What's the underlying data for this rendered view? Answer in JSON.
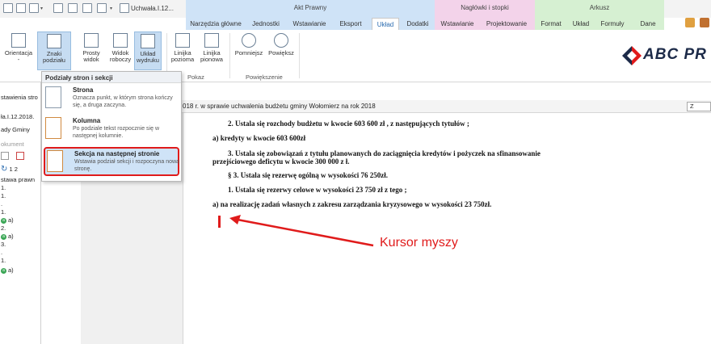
{
  "title_bar": {
    "document_title": "Uchwała.I.12...",
    "context_groups": [
      {
        "title": "Akt Prawny",
        "color": "#cfe3f7"
      },
      {
        "title": "Nagłówki i stopki",
        "color": "#f3d3ea"
      },
      {
        "title": "Arkusz",
        "color": "#d6f0d2"
      }
    ]
  },
  "tabs": [
    "Narzędzia główne",
    "Jednostki",
    "Wstawianie",
    "Eksport",
    "Układ",
    "Dodatki",
    "Wstawianie",
    "Projektowanie",
    "Format",
    "Układ",
    "Formuły",
    "Dane"
  ],
  "active_tab": "Układ",
  "ribbon": {
    "buttons": [
      {
        "label": "Orientacja",
        "sub": "-"
      },
      {
        "label": "Znaki",
        "sub": "podziału"
      },
      {
        "label": "Prosty",
        "sub": "widok"
      },
      {
        "label": "Widok",
        "sub": "roboczy"
      },
      {
        "label": "Układ",
        "sub": "wydruku"
      },
      {
        "label": "Linijka",
        "sub": "pozioma"
      },
      {
        "label": "Linijka",
        "sub": "pionowa"
      },
      {
        "label": "Pomniejsz",
        "sub": ""
      },
      {
        "label": "Powiększ",
        "sub": ""
      }
    ],
    "groups": {
      "pokaz": "Pokaz",
      "powiekszenie": "Powiększenie"
    }
  },
  "logo": {
    "text": "ABC PR",
    "color": "#1c2a48",
    "accent": "#e01b1b"
  },
  "left_panel": {
    "lines": [
      "stawienia stro",
      "ła.I.12.2018.",
      "ady Gminy",
      "okument",
      "1  2",
      "stawa prawn",
      "1.",
      "1.",
      ".",
      "1.",
      "a)",
      "2.",
      "a)",
      "3.",
      ".",
      "1.",
      "a)"
    ]
  },
  "dropdown": {
    "header": "Podziały stron i sekcji",
    "items": [
      {
        "title": "Strona",
        "desc": "Oznacza punkt, w którym strona kończy się, a druga zaczyna."
      },
      {
        "title": "Kolumna",
        "desc": "Po podziale tekst rozpocznie się w następnej kolumnie."
      },
      {
        "title": "Sekcja na następnej stronie",
        "desc": "Wstawia podział sekcji i rozpoczyna nową stronę."
      }
    ]
  },
  "doc_header": {
    "text": "018 r. w sprawie uchwalenia budżetu gminy Wołomierz na rok 2018",
    "right_button": "Z"
  },
  "document_lines": [
    "2. Ustala się  rozchody budżetu w kwocie 603 600 zł , z następujących tytułów ;",
    "a) kredyty w kwocie 603 600zł",
    "3. Ustala się zobowiązań z tytułu planowanych do zaciągnięcia kredytów i pożyczek na sfinansowanie",
    "przejściowego deficytu w kwocie 300 000 z ł.",
    "§ 3. Ustala się  rezerwę ogólną w wysokości 76 250zł.",
    "1. Ustala się  rezerwy celowe w wysokości 23 750 zł z tego ;",
    "a) na realizację zadań własnych z zakresu zarządzania kryzysowego w wysokości 23 750zł."
  ],
  "annotation": {
    "label": "Kursor myszy",
    "color": "#e01b1b"
  }
}
